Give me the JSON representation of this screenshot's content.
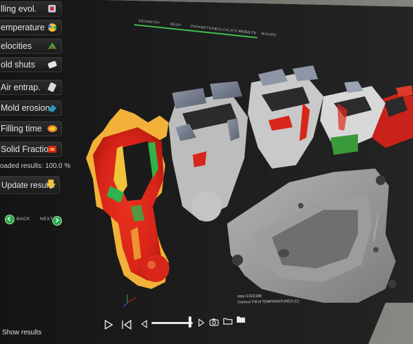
{
  "sidebar": {
    "items": [
      {
        "label": "lling evol.",
        "icon": "filling-evolution-icon"
      },
      {
        "label": "emperature",
        "icon": "temperature-icon"
      },
      {
        "label": "elocities",
        "icon": "velocities-icon"
      },
      {
        "label": "old shuts",
        "icon": "cold-shuts-icon"
      },
      {
        "label": "Air entrap.",
        "icon": "air-entrapment-icon"
      },
      {
        "label": "Mold erosion",
        "icon": "mold-erosion-icon"
      },
      {
        "label": "Filling time",
        "icon": "filling-time-icon"
      },
      {
        "label": "Solid Fraction",
        "icon": "solid-fraction-icon"
      }
    ],
    "loaded_results": "oaded results: 100.0 %",
    "update_label": "Update results",
    "back_label": "BACK",
    "next_label": "NEXT",
    "show_results": "Show results"
  },
  "tabs": [
    "GEOMETRY",
    "MESH",
    "PARAMETERS",
    "CALCULATE",
    "RESULTS",
    "WIZARD"
  ],
  "active_tab": "RESULTS",
  "readout": {
    "step": "step 0.022188",
    "contour": "Contour Fill of TEMPERATURES (C)"
  },
  "legend_title": "TEMPERATURES (C)",
  "timeline_position": 0.93,
  "colors": {
    "accent": "#3fbf4e",
    "hot": "#e0261c",
    "mid": "#f2c23a",
    "cool": "#2fb34a",
    "part_grey": "#9a9a9a",
    "mold_blue": "#7c8494"
  }
}
